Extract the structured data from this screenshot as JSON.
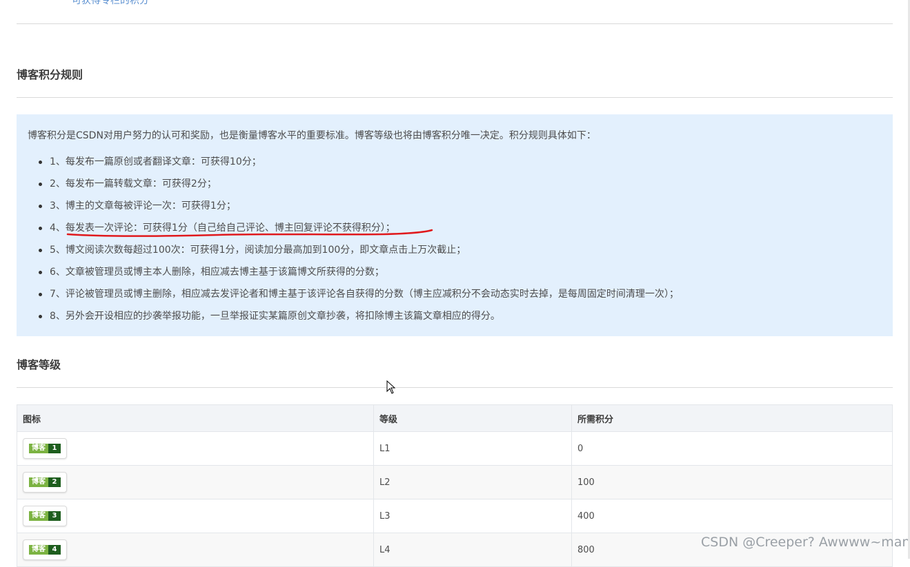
{
  "top_link": "可获得专栏的积分",
  "score_section": {
    "title": "博客积分规则",
    "intro": "博客积分是CSDN对用户努力的认可和奖励，也是衡量博客水平的重要标准。博客等级也将由博客积分唯一决定。积分规则具体如下：",
    "rules": [
      "1、每发布一篇原创或者翻译文章：可获得10分；",
      "2、每发布一篇转载文章：可获得2分；",
      "3、博主的文章每被评论一次：可获得1分；",
      "4、每发表一次评论：可获得1分（自己给自己评论、博主回复评论不获得积分）；",
      "5、博文阅读次数每超过100次：可获得1分，阅读加分最高加到100分，即文章点击上万次截止；",
      "6、文章被管理员或博主本人删除，相应减去博主基于该篇博文所获得的分数；",
      "7、评论被管理员或博主删除，相应减去发评论者和博主基于该评论各自获得的分数（博主应减积分不会动态实时去掉，是每周固定时间清理一次）；",
      "8、另外会开设相应的抄袭举报功能，一旦举报证实某篇原创文章抄袭，将扣除博主该篇文章相应的得分。"
    ],
    "underline_color": "#e0191c"
  },
  "level_section": {
    "title": "博客等级",
    "headers": [
      "图标",
      "等级",
      "所需积分"
    ],
    "rows": [
      {
        "badge_text": "博客",
        "badge_num": "1",
        "level": "L1",
        "points": "0"
      },
      {
        "badge_text": "博客",
        "badge_num": "2",
        "level": "L2",
        "points": "100"
      },
      {
        "badge_text": "博客",
        "badge_num": "3",
        "level": "L3",
        "points": "400"
      },
      {
        "badge_text": "博客",
        "badge_num": "4",
        "level": "L4",
        "points": "800"
      }
    ]
  },
  "watermark": "CSDN @Creeper? Awwww~man!",
  "colors": {
    "rules_box_bg": "#e3f0fd",
    "badge_green": "#7cb342",
    "badge_dark": "#1e5e1e"
  }
}
